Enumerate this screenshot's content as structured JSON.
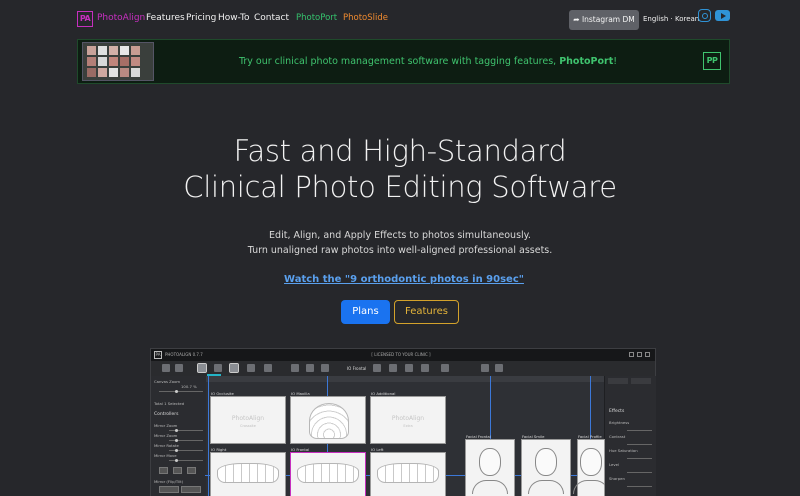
{
  "nav": {
    "logo_mark": "PA",
    "brand": "PhotoAlign",
    "links": [
      "Features",
      "Pricing",
      "How-To",
      "Contact"
    ],
    "product_links": [
      "PhotoPort",
      "PhotoSlide"
    ],
    "instagram_btn": "Instagram DM",
    "language": "English · Korean",
    "icons": [
      "paper-plane-icon",
      "instagram-icon",
      "youtube-icon"
    ]
  },
  "banner": {
    "text_prefix": "Try our clinical photo management software with tagging features, ",
    "text_bold": "PhotoPort",
    "text_suffix": "!",
    "logo_mark": "PP"
  },
  "hero": {
    "title_line1": "Fast and High-Standard",
    "title_line2": "Clinical Photo Editing Software",
    "sub_line1": "Edit, Align, and Apply Effects to photos simultaneously.",
    "sub_line2": "Turn unaligned raw photos into well-aligned professional assets.",
    "watch_link": "Watch the \"9 orthodontic photos in 90sec\"",
    "plans_btn": "Plans",
    "features_btn": "Features"
  },
  "app": {
    "title": "PHOTOALIGN 0.7.7",
    "center_title": "[ LICENSED TO YOUR CLINIC ]",
    "toolbar_label": "IO Frontal",
    "left_panel": {
      "canvas_zoom": "Canvas Zoom",
      "zoom_value": "100.7 %",
      "total": "Total 1 Selected",
      "controllers": "Controllers",
      "rows": [
        "Mirror Zoom",
        "Mirror Zoom",
        "Mirror Rotate",
        "Mirror Move"
      ],
      "mirror_flip": "Mirror (Flip/Tilt)"
    },
    "photos": [
      {
        "label": "IO Occlusite",
        "wm": "PhotoAlign",
        "wm2": "Crosssite"
      },
      {
        "label": "IO Maxilla",
        "wm": "",
        "wm2": ""
      },
      {
        "label": "IO Additional",
        "wm": "PhotoAlign",
        "wm2": "Extra"
      },
      {
        "label": "IO Right",
        "wm": "",
        "wm2": ""
      },
      {
        "label": "IO Frontal",
        "wm": "",
        "wm2": ""
      },
      {
        "label": "IO Left",
        "wm": "",
        "wm2": ""
      },
      {
        "label": "Facial Frontal",
        "wm": "",
        "wm2": ""
      },
      {
        "label": "Facial Smile",
        "wm": "",
        "wm2": ""
      },
      {
        "label": "Facial Profile",
        "wm": "",
        "wm2": ""
      }
    ],
    "right_panel": {
      "effects": "Effects",
      "rows": [
        "Brightness",
        "Contrast",
        "Hue Saturation",
        "Level",
        "Sharpen"
      ]
    }
  }
}
